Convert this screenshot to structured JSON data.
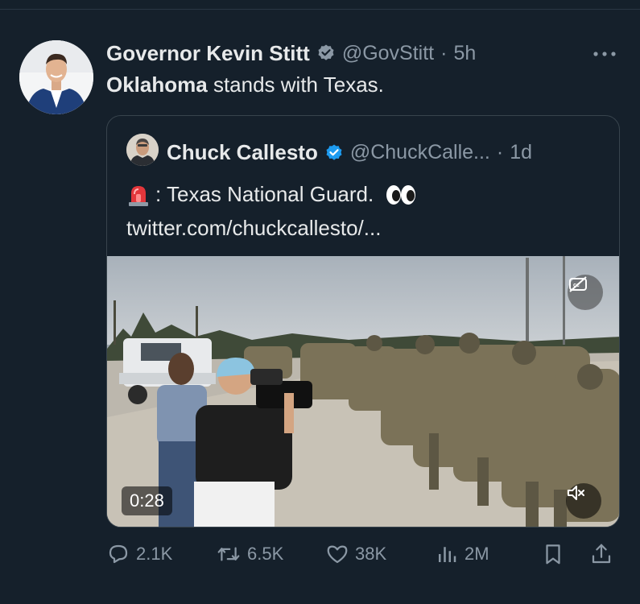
{
  "tweet": {
    "author_name": "Governor Kevin Stitt",
    "handle": "@GovStitt",
    "separator": "·",
    "time": "5h",
    "text_bold": "Oklahoma",
    "text_rest": " stands with Texas.",
    "more_icon": "more-icon",
    "verified_icon": "verified-badge-icon"
  },
  "quote": {
    "author_name": "Chuck Callesto",
    "handle": "@ChuckCalle...",
    "separator": "·",
    "time": "1d",
    "siren_icon": "siren-emoji-icon",
    "line1_text": ": Texas National Guard.",
    "eyes_icon": "eyes-emoji-icon",
    "link_text": "twitter.com/chuckcallesto/...",
    "video": {
      "duration": "0:28",
      "cc_icon": "captions-off-icon",
      "mute_icon": "volume-muted-icon"
    }
  },
  "actions": {
    "replies": "2.1K",
    "reposts": "6.5K",
    "likes": "38K",
    "views": "2M"
  },
  "colors": {
    "background": "#15202b",
    "text": "#e7e9ea",
    "secondary_text": "#8b98a5",
    "verified": "#1d9bf0",
    "border": "#38444d"
  }
}
